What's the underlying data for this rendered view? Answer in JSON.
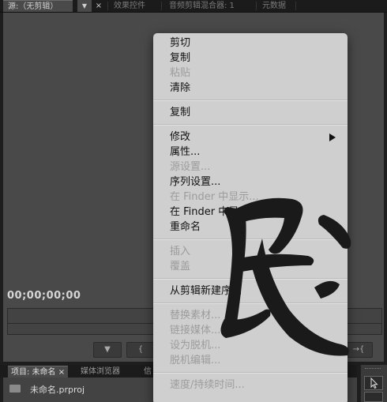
{
  "top_tabs": {
    "source": "源:（无剪辑）",
    "effects": "效果控件",
    "audio_mixer": "音频剪辑混合器: 1",
    "metadata": "元数据",
    "close": "×",
    "dropdown": "▼"
  },
  "monitor": {
    "timecode": "00;00;00;00",
    "controls": [
      "▼",
      "{",
      "→{"
    ]
  },
  "bottom_tabs": {
    "project": "项目: 未命名",
    "close": "×",
    "media_browser": "媒体浏览器",
    "info": "信"
  },
  "project": {
    "file": "未命名.prproj"
  },
  "menu": {
    "items": [
      {
        "label": "剪切",
        "enabled": true
      },
      {
        "label": "复制",
        "enabled": true
      },
      {
        "label": "粘贴",
        "enabled": false
      },
      {
        "label": "清除",
        "enabled": true
      },
      {
        "label": "复制",
        "enabled": true
      },
      {
        "label": "修改",
        "enabled": true,
        "submenu": true
      },
      {
        "label": "属性...",
        "enabled": true
      },
      {
        "label": "源设置...",
        "enabled": false
      },
      {
        "label": "序列设置...",
        "enabled": true
      },
      {
        "label": "在 Finder 中显示...",
        "enabled": false
      },
      {
        "label": "在 Finder 中显示项目...",
        "enabled": true
      },
      {
        "label": "重命名",
        "enabled": true
      },
      {
        "label": "插入",
        "enabled": false
      },
      {
        "label": "覆盖",
        "enabled": false
      },
      {
        "label": "从剪辑新建序列",
        "enabled": true
      },
      {
        "label": "替换素材...",
        "enabled": false
      },
      {
        "label": "链接媒体...",
        "enabled": false
      },
      {
        "label": "设为脱机...",
        "enabled": false
      },
      {
        "label": "脱机编辑...",
        "enabled": false
      },
      {
        "label": "速度/持续时间...",
        "enabled": false
      }
    ]
  },
  "colors": {
    "menu_bg": "#cfcfcf",
    "panel_bg": "#494949",
    "app_bg": "#1e1e1e",
    "ink": "#1a1a1a"
  },
  "watermark": {
    "glyph": "民"
  }
}
